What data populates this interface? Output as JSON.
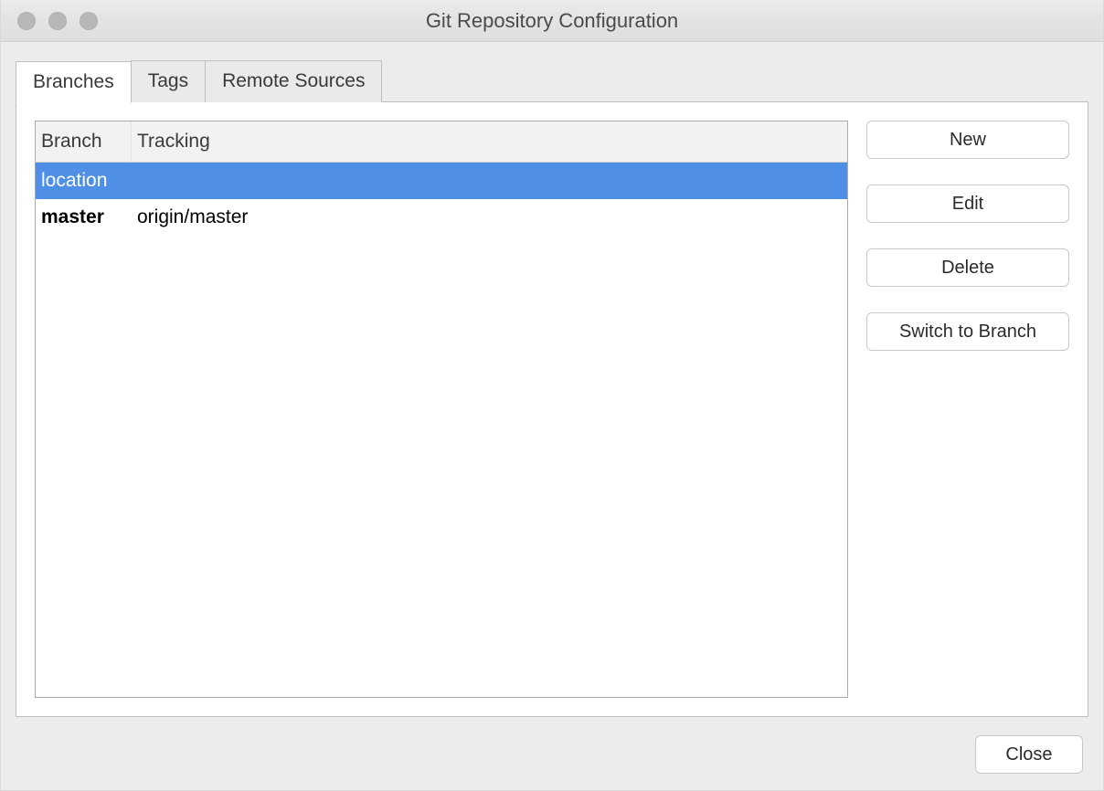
{
  "window": {
    "title": "Git Repository Configuration"
  },
  "tabs": [
    {
      "label": "Branches",
      "active": true
    },
    {
      "label": "Tags",
      "active": false
    },
    {
      "label": "Remote Sources",
      "active": false
    }
  ],
  "table": {
    "columns": {
      "branch": "Branch",
      "tracking": "Tracking"
    },
    "rows": [
      {
        "branch": "location",
        "tracking": "",
        "selected": true,
        "current": false
      },
      {
        "branch": "master",
        "tracking": "origin/master",
        "selected": false,
        "current": true
      }
    ]
  },
  "actions": {
    "new": "New",
    "edit": "Edit",
    "delete": "Delete",
    "switch": "Switch to Branch"
  },
  "footer": {
    "close": "Close"
  }
}
